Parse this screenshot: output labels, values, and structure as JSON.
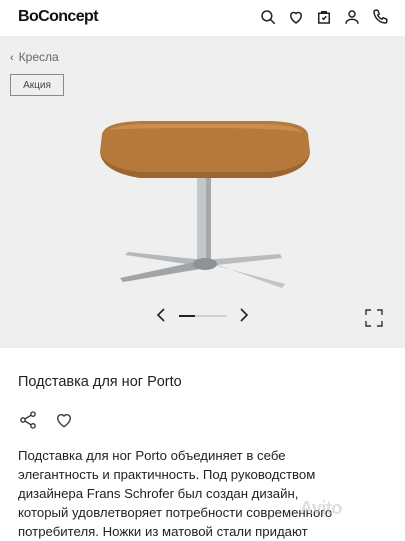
{
  "header": {
    "logo_text": "BoConcept",
    "icons": [
      "search-icon",
      "heart-icon",
      "bag-icon",
      "user-icon",
      "phone-icon"
    ]
  },
  "gallery": {
    "breadcrumb": "Кресла",
    "badge": "Акция",
    "colors": {
      "background": "#efefef",
      "seat": "#b57a3b",
      "metal": "#bfc3c6"
    },
    "pager_icons": [
      "chevron-left-icon",
      "chevron-right-icon",
      "expand-icon"
    ]
  },
  "product": {
    "title": "Подставка для ног Porto",
    "description_lines": [
      "Подставка для ног Porto объединяет в себе",
      "элегантность и практичность. Под руководством",
      "дизайнера Frans Schrofer был создан дизайн,",
      "который удовлетворяет потребности современного",
      "потребителя. Ножки из матовой стали придают"
    ],
    "action_icons": [
      "share-icon",
      "favorite-heart-icon"
    ]
  },
  "watermark": "Avito"
}
